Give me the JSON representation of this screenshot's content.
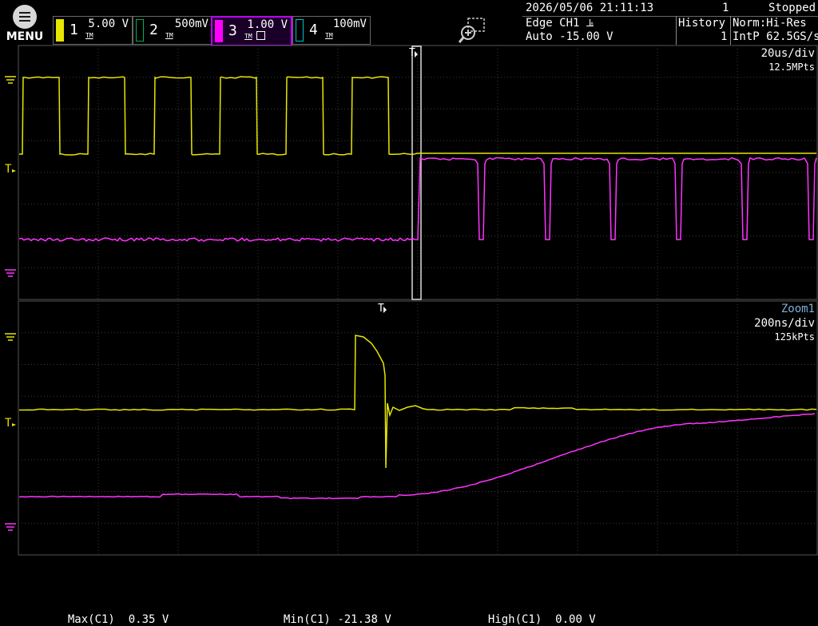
{
  "menu": {
    "label": "MENU"
  },
  "channels": [
    {
      "number": "1",
      "scale": "5.00 V",
      "color": "#e6e600",
      "icon": "TM"
    },
    {
      "number": "2",
      "scale": "500mV",
      "color": "#00b050",
      "icon": "TM"
    },
    {
      "number": "3",
      "scale": "1.00 V",
      "color": "#ff00ff",
      "icon": "TM",
      "selected": true
    },
    {
      "number": "4",
      "scale": "100mV",
      "color": "#00c0c0",
      "icon": "TM"
    }
  ],
  "status": {
    "datetime": "2026/05/06 21:11:13",
    "count": "1",
    "state": "Stopped",
    "trigger_line1": "Edge CH1 ⫡",
    "trigger_line2": "Auto -15.00 V",
    "history_label": "History",
    "history_value": "1",
    "mode_line1": "Norm:Hi-Res",
    "mode_line2": "IntP 62.5GS/s"
  },
  "main_display": {
    "timebase": "20us/div",
    "points": "12.5MPts"
  },
  "zoom_display": {
    "label": "Zoom1",
    "timebase": "200ns/div",
    "points": "125kPts"
  },
  "measurements": [
    {
      "label": "Max(C1)",
      "value": "0.35 V"
    },
    {
      "label": "Min(C1)",
      "value": "-21.38 V"
    },
    {
      "label": "High(C1)",
      "value": "0.00 V"
    }
  ],
  "colors": {
    "ch1": "#e6e600",
    "ch3": "#ff33ff",
    "grid": "#3a3a3a",
    "zoom_label": "#7fb0d8"
  }
}
